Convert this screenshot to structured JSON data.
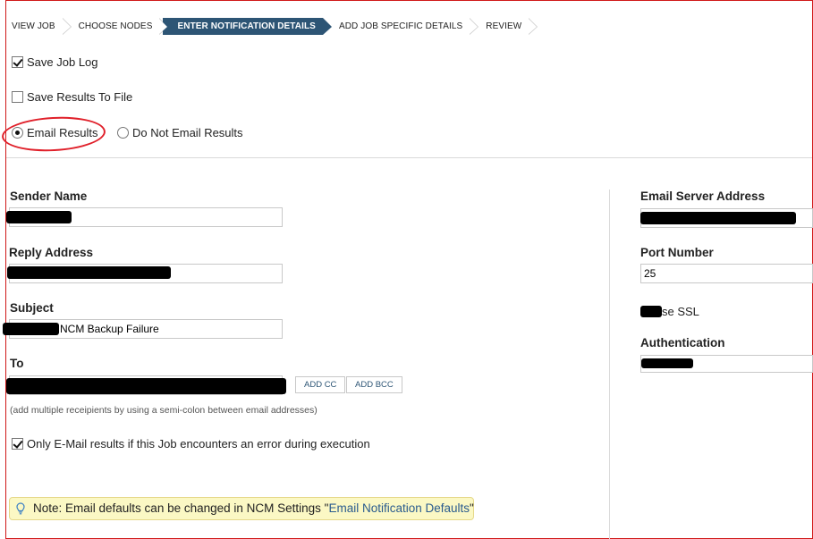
{
  "breadcrumb": [
    {
      "label": "VIEW JOB",
      "active": false
    },
    {
      "label": "CHOOSE NODES",
      "active": false
    },
    {
      "label": "ENTER NOTIFICATION DETAILS",
      "active": true
    },
    {
      "label": "ADD JOB SPECIFIC DETAILS",
      "active": false
    },
    {
      "label": "REVIEW",
      "active": false
    }
  ],
  "options": {
    "save_job_log": {
      "label": "Save Job Log",
      "checked": true
    },
    "save_results_to_file": {
      "label": "Save Results To File",
      "checked": false
    },
    "email_results": {
      "label": "Email Results",
      "selected": true
    },
    "do_not_email_results": {
      "label": "Do Not Email Results",
      "selected": false
    }
  },
  "form": {
    "sender_name": {
      "label": "Sender Name",
      "value": ""
    },
    "reply_address": {
      "label": "Reply Address",
      "value": ""
    },
    "subject": {
      "label": "Subject",
      "value": "NCM Backup Failure"
    },
    "to": {
      "label": "To",
      "value": ""
    },
    "add_cc": "ADD CC",
    "add_bcc": "ADD BCC",
    "hint": "(add multiple receipients by using a semi-colon between email addresses)",
    "only_on_error": {
      "label": "Only E-Mail results if this Job encounters an error during execution",
      "checked": true
    }
  },
  "server": {
    "email_server_address": {
      "label": "Email Server Address",
      "value": ""
    },
    "port_number": {
      "label": "Port Number",
      "value": "25"
    },
    "use_ssl": {
      "label": "se SSL"
    },
    "authentication": {
      "label": "Authentication",
      "value": ""
    }
  },
  "note": {
    "prefix": "Note: Email defaults can be changed in NCM Settings \"",
    "link": "Email Notification Defaults",
    "suffix": "\""
  },
  "colors": {
    "accent": "#2d5575",
    "annotation": "#e0202a",
    "note_bg": "#fbf8c4"
  }
}
